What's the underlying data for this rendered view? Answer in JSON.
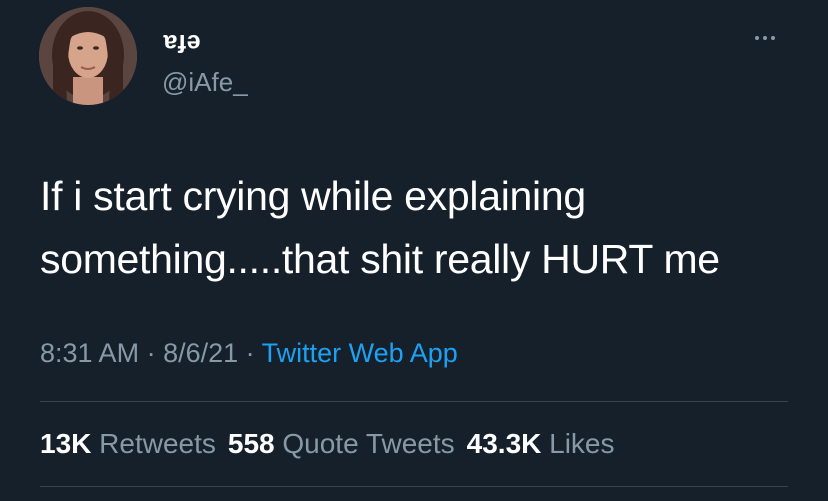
{
  "tweet": {
    "author": {
      "display_name": "efa",
      "handle": "@iAfe_"
    },
    "more_icon": "more-horizontal-icon",
    "text_line1": "If i start crying while explaining",
    "text_line2": "something.....that shit really HURT me",
    "time": "8:31 AM",
    "date": "8/6/21",
    "separator": " · ",
    "source": "Twitter Web App",
    "stats": {
      "retweets_count": "13K",
      "retweets_label": "Retweets",
      "quotes_count": "558",
      "quotes_label": "Quote Tweets",
      "likes_count": "43.3K",
      "likes_label": "Likes"
    }
  },
  "colors": {
    "background": "#15202b",
    "text": "#ffffff",
    "secondary": "#8899a6",
    "link": "#1da1f2",
    "divider": "#38444d"
  }
}
